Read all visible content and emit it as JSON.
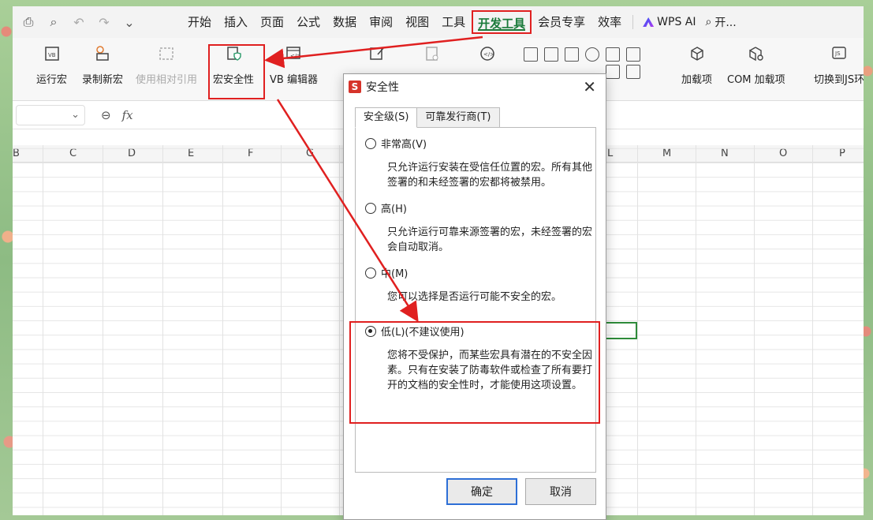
{
  "quick_access": {
    "icons": [
      "print-icon",
      "print-preview-icon",
      "undo-icon",
      "redo-icon",
      "chevron-down-icon"
    ]
  },
  "menus": [
    "开始",
    "插入",
    "页面",
    "公式",
    "数据",
    "审阅",
    "视图",
    "工具",
    "开发工具",
    "会员专享",
    "效率"
  ],
  "active_menu": "开发工具",
  "wps_ai": "WPS AI",
  "search_label": "开...",
  "ribbon": {
    "run_macro": "运行宏",
    "record_macro": "录制新宏",
    "relative_ref": "使用相对引用",
    "macro_security": "宏安全性",
    "vb_editor": "VB 编辑器",
    "addins": "加载项",
    "com_addins": "COM 加载项",
    "switch_js": "切换到JS环"
  },
  "formula_bar": {
    "fx": "fx"
  },
  "columns": [
    "B",
    "C",
    "D",
    "E",
    "F",
    "G",
    "L",
    "M",
    "N",
    "O",
    "P"
  ],
  "dialog": {
    "title": "安全性",
    "close": "✕",
    "tabs": [
      "安全级(S)",
      "可靠发行商(T)"
    ],
    "options": [
      {
        "label": "非常高(V)",
        "desc": "只允许运行安装在受信任位置的宏。所有其他签署的和未经签署的宏都将被禁用。",
        "selected": false
      },
      {
        "label": "高(H)",
        "desc": "只允许运行可靠来源签署的宏，未经签署的宏会自动取消。",
        "selected": false
      },
      {
        "label": "中(M)",
        "desc": "您可以选择是否运行可能不安全的宏。",
        "selected": false
      },
      {
        "label": "低(L)(不建议使用)",
        "desc": "您将不受保护，而某些宏具有潜在的不安全因素。只有在安装了防毒软件或检查了所有要打开的文档的安全性时，才能使用这项设置。",
        "selected": true
      }
    ],
    "ok": "确定",
    "cancel": "取消"
  },
  "colors": {
    "accent_red": "#e02020",
    "active_green": "#1a7a3a",
    "primary_blue": "#2d6fd6"
  }
}
